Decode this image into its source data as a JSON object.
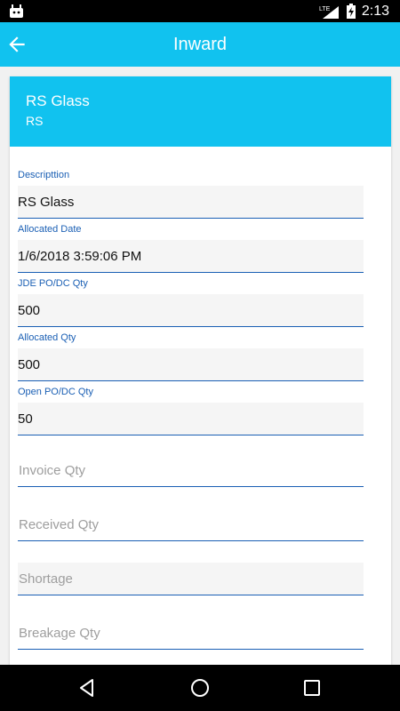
{
  "status_bar": {
    "time": "2:13",
    "network": "LTE"
  },
  "app_bar": {
    "title": "Inward"
  },
  "card": {
    "name": "RS Glass",
    "code": "RS"
  },
  "fields": [
    {
      "label": "Descripttion",
      "value": "RS Glass"
    },
    {
      "label": "Allocated Date",
      "value": "1/6/2018 3:59:06 PM"
    },
    {
      "label": "JDE PO/DC Qty",
      "value": "500"
    },
    {
      "label": "Allocated Qty",
      "value": "500"
    },
    {
      "label": "Open PO/DC Qty",
      "value": "50"
    }
  ],
  "inputs": [
    {
      "placeholder": "Invoice Qty"
    },
    {
      "placeholder": "Received Qty"
    },
    {
      "placeholder": "Shortage"
    },
    {
      "placeholder": "Breakage Qty"
    }
  ],
  "colors": {
    "primary": "#11c2ef",
    "accent_line": "#1a5fb4"
  }
}
